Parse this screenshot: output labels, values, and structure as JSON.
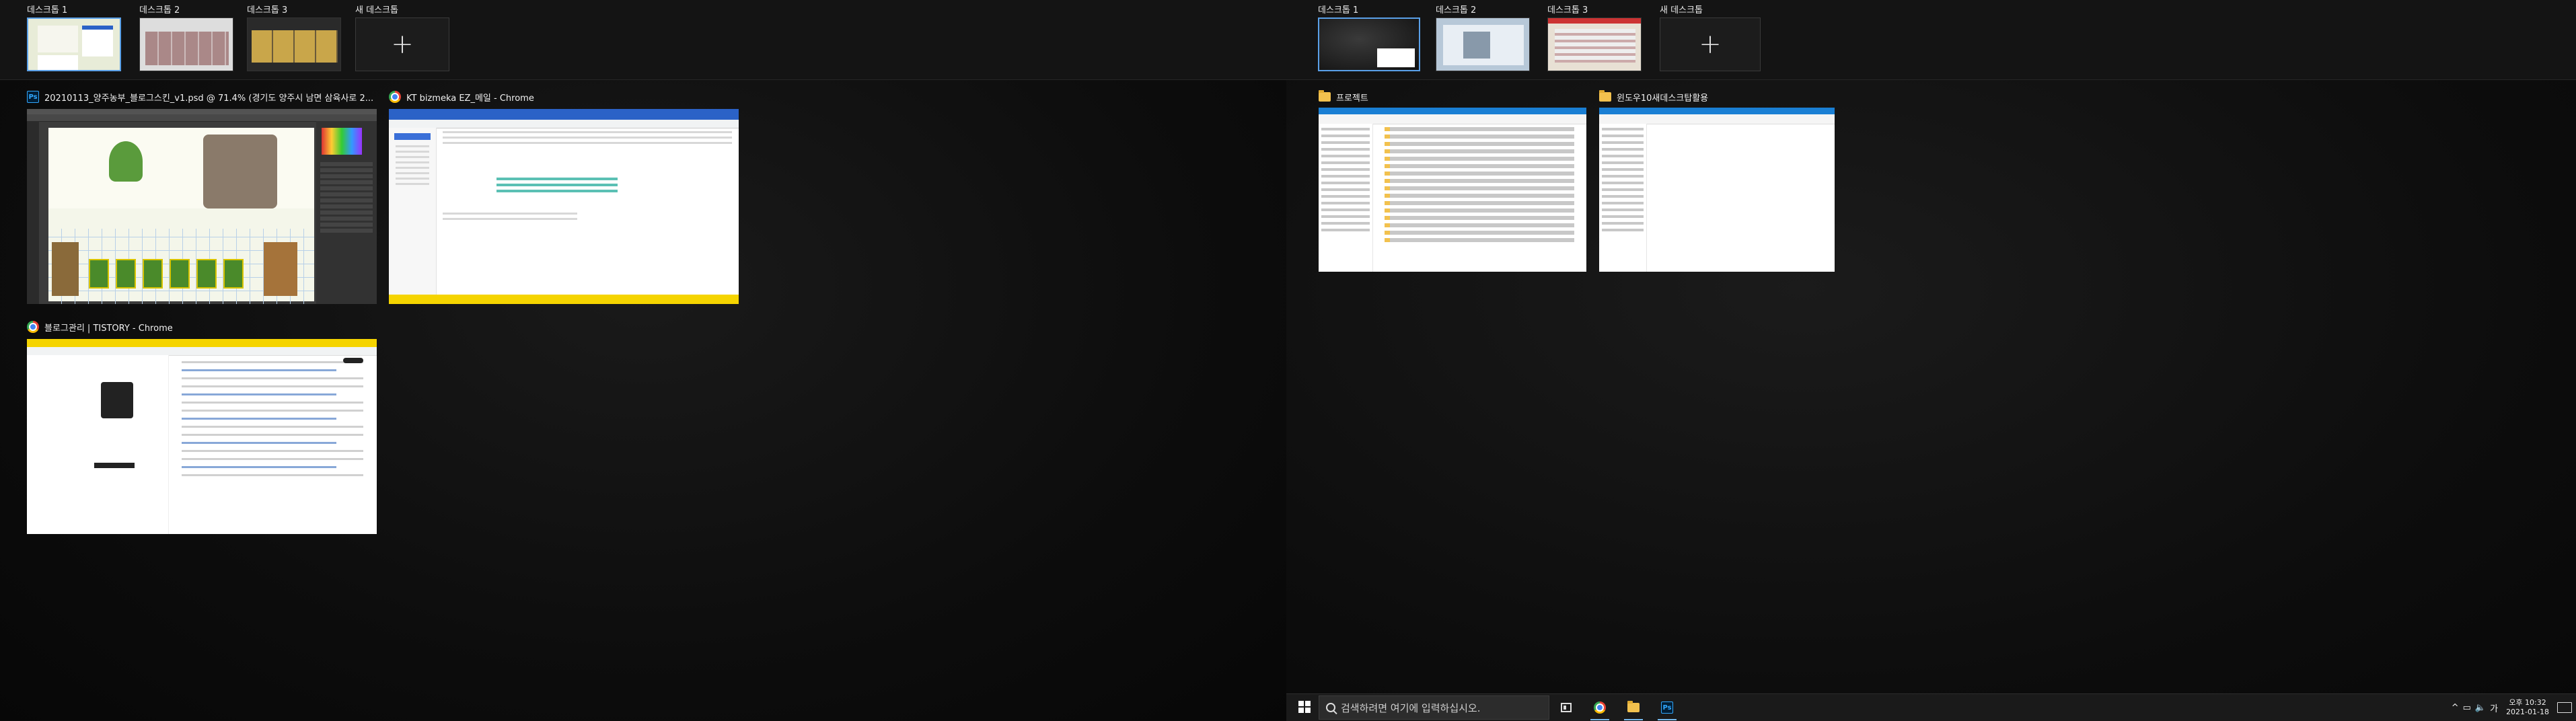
{
  "left_monitor": {
    "desktops": [
      {
        "label": "데스크톱 1",
        "active": true
      },
      {
        "label": "데스크톱 2",
        "active": false
      },
      {
        "label": "데스크톱 3",
        "active": false
      }
    ],
    "new_desktop_label": "새 데스크톱",
    "windows": [
      {
        "app": "photoshop",
        "icon_text": "Ps",
        "title": "20210113_양주농부_블로그스킨_v1.psd @ 71.4% (경기도 양주시 남면 삼육사로 2..."
      },
      {
        "app": "chrome",
        "title": "KT bizmeka EZ_메일 - Chrome"
      },
      {
        "app": "chrome",
        "title": "블로그관리 | TISTORY - Chrome"
      }
    ]
  },
  "right_monitor": {
    "desktops": [
      {
        "label": "데스크톱 1",
        "active": true
      },
      {
        "label": "데스크톱 2",
        "active": false
      },
      {
        "label": "데스크톱 3",
        "active": false
      }
    ],
    "new_desktop_label": "새 데스크톱",
    "windows": [
      {
        "app": "explorer",
        "title": "프로젝트"
      },
      {
        "app": "explorer",
        "title": "윈도우10새데스크탑활용"
      }
    ]
  },
  "taskbar": {
    "search_placeholder": "검색하려면 여기에 입력하십시오.",
    "pinned": [
      "task-view-icon",
      "chrome-icon",
      "file-explorer-icon",
      "photoshop-icon"
    ],
    "photoshop_icon_text": "Ps",
    "tray": {
      "expand": "^",
      "ime": "가",
      "time": "오후 10:32",
      "date": "2021-01-18"
    }
  }
}
